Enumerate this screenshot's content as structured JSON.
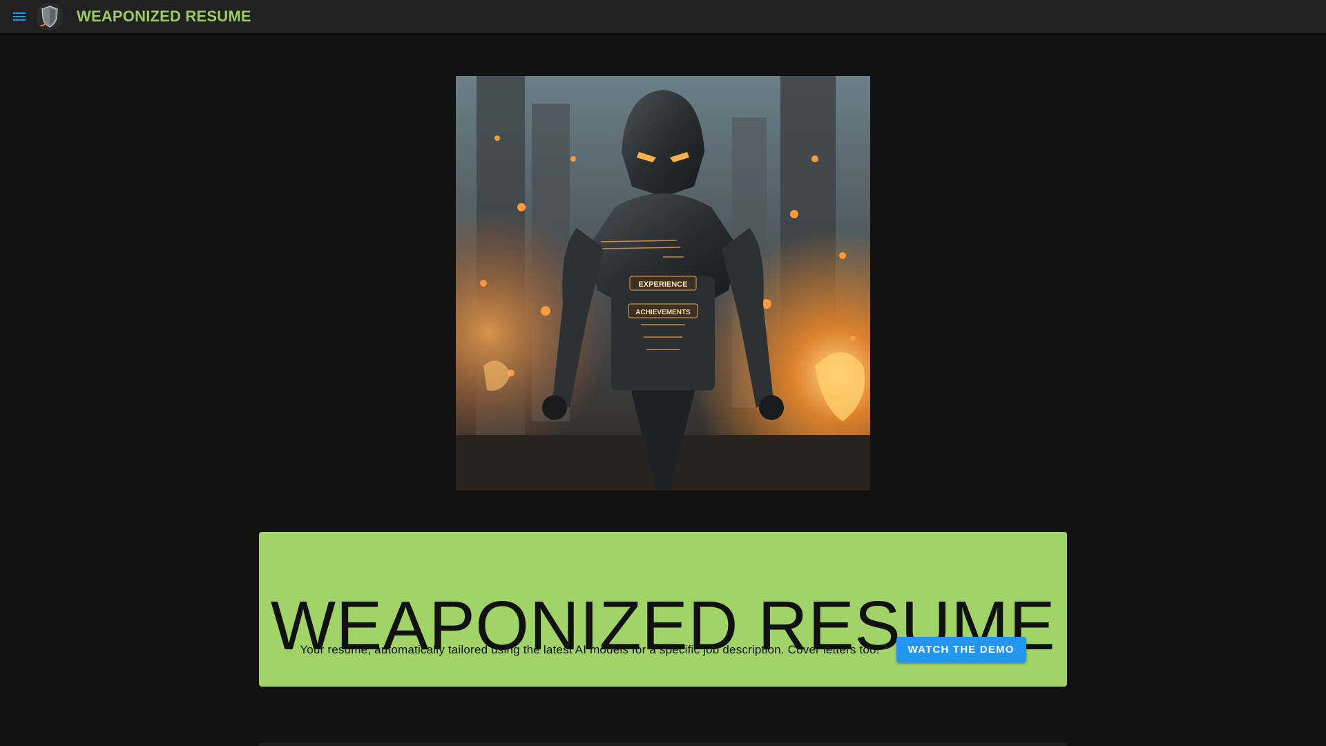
{
  "appbar": {
    "menu_icon": "hamburger-menu-icon",
    "logo": "shield-logo-icon",
    "title": "WEAPONIZED RESUME",
    "title_color": "#9ccc65",
    "background": "#212121"
  },
  "hero": {
    "image": "armored-robot-knight-in-burning-city",
    "chest_labels": [
      "EXPERIENCE",
      "ACHIEVEMENTS"
    ]
  },
  "banner": {
    "background": "#a0d468",
    "title": "WEAPONIZED RESUME",
    "tagline": "Your resume, automatically tailored using the latest AI models for a specific job description. Cover letters too!",
    "button_label": "WATCH THE DEMO",
    "button_color": "#2196f3"
  }
}
